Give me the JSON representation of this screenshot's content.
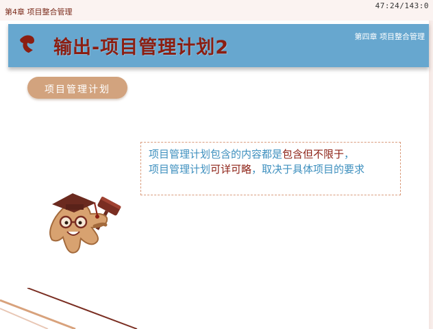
{
  "topbar": {
    "chapter_label": "第4章 项目整合管理",
    "timer": "47:24/143:0"
  },
  "banner": {
    "icon": "bullet-swirl-icon",
    "title": "输出-项目管理计划2",
    "subtitle": "第四章 项目整合管理"
  },
  "section": {
    "pill_label": "项目管理计划"
  },
  "content": {
    "line1_a": "项目管理计划包含的内容都是",
    "line1_b": "包含但不限于",
    "line1_c": "，",
    "line2_a": "项目管理计划",
    "line2_b": "可详可略",
    "line2_c": "，取决于具体项目的要求"
  },
  "mascot": {
    "icon": "gavel-mascot-icon"
  },
  "colors": {
    "banner_bg": "#67a7cf",
    "title_red": "#8b1e12",
    "pill_bg": "#d2a37e",
    "text_blue": "#3d8fbe",
    "dashed_border": "#d99a7a"
  }
}
